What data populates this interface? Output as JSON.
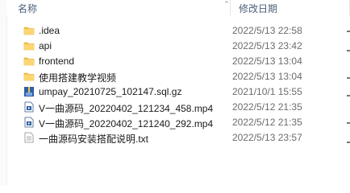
{
  "header": {
    "name_label": "名称",
    "date_label": "修改日期"
  },
  "files": [
    {
      "name": ".idea",
      "date": "2022/5/13 22:58",
      "icon": "folder-icon"
    },
    {
      "name": "api",
      "date": "2022/5/13 23:42",
      "icon": "folder-icon"
    },
    {
      "name": "frontend",
      "date": "2022/5/13 13:04",
      "icon": "folder-icon"
    },
    {
      "name": "使用搭建教学视频",
      "date": "2022/5/13 13:04",
      "icon": "folder-icon"
    },
    {
      "name": "umpay_20210725_102147.sql.gz",
      "date": "2021/10/1 15:55",
      "icon": "archive-icon"
    },
    {
      "name": "V一曲源码_20220402_121234_458.mp4",
      "date": "2022/5/12 21:35",
      "icon": "video-icon"
    },
    {
      "name": "V一曲源码_20220402_121240_292.mp4",
      "date": "2022/5/12 21:35",
      "icon": "video-icon"
    },
    {
      "name": "一曲源码安装搭配说明.txt",
      "date": "2022/5/13 23:57",
      "icon": "text-icon"
    }
  ],
  "colors": {
    "folder": "#f6c244",
    "header_text": "#4c607a",
    "date_text": "#6b6b6b"
  }
}
